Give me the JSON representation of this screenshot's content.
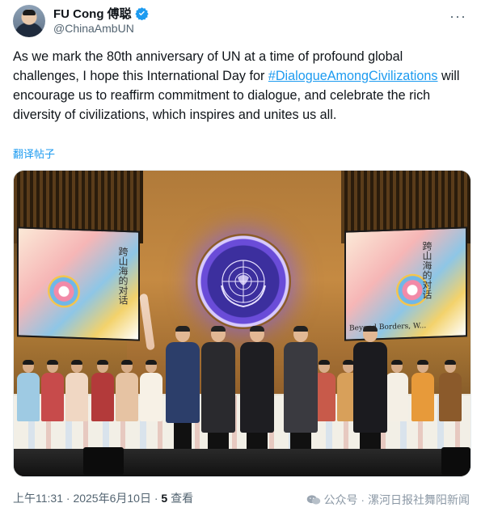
{
  "author": {
    "name": "FU Cong 傅聪",
    "handle": "@ChinaAmbUN",
    "verified": true
  },
  "tweet": {
    "text_before": "As we mark the 80th anniversary of UN at a time of profound global challenges, I hope this International Day for ",
    "hashtag": "#DialogueAmongCivilizations",
    "text_after": " will encourage us to reaffirm commitment to dialogue, and celebrate the rich diversity of civilizations, which inspires and unites us all.",
    "translate_label": "翻译帖子"
  },
  "photo": {
    "screen_text_left": "跨山海的对话",
    "screen_text_right": "跨山海的对话",
    "screen_caption_right": "Beyond Borders, W..."
  },
  "meta": {
    "time": "上午11:31",
    "dot1": " · ",
    "date": "2025年6月10日",
    "dot2": " · ",
    "views_count": "5",
    "views_label": " 查看"
  },
  "watermark": {
    "text": "公众号 · 漯河日报社舞阳新闻"
  },
  "icons": {
    "verified": "verified-badge-icon",
    "more": "more-options-icon",
    "watermark": "wechat-icon"
  },
  "colors": {
    "link": "#1d9bf0",
    "secondary_text": "#536471",
    "primary_text": "#0f1419"
  }
}
